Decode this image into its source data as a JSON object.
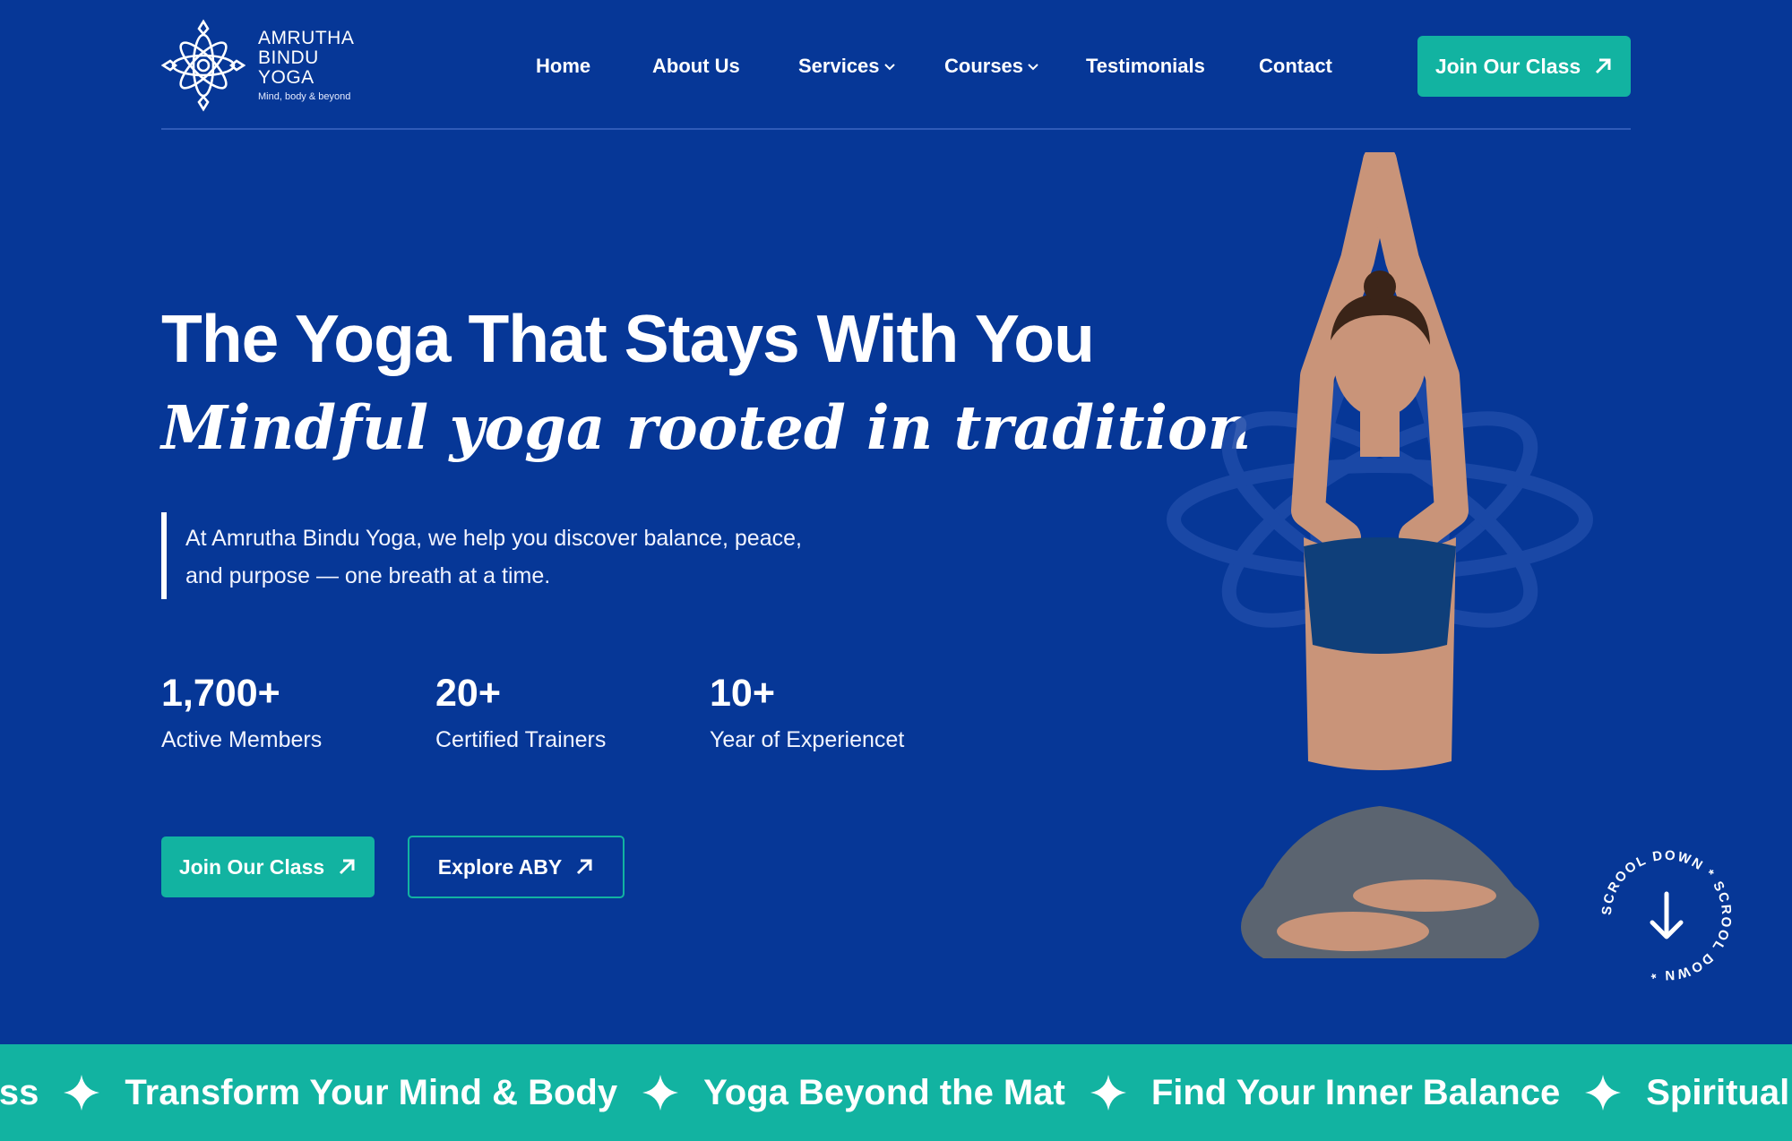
{
  "brand": {
    "line1": "AMRUTHA",
    "line2": "BINDU",
    "line3": "YOGA",
    "tagline": "Mind, body & beyond",
    "logo_icon": "lotus-knot-icon"
  },
  "nav": {
    "items": [
      {
        "label": "Home",
        "has_dropdown": false
      },
      {
        "label": "About Us",
        "has_dropdown": false
      },
      {
        "label": "Services",
        "has_dropdown": true
      },
      {
        "label": "Courses",
        "has_dropdown": true
      },
      {
        "label": "Testimonials",
        "has_dropdown": false
      },
      {
        "label": "Contact",
        "has_dropdown": false
      }
    ],
    "cta_label": "Join Our Class"
  },
  "hero": {
    "headline": "The Yoga That Stays With You",
    "subhead": "Mindful yoga rooted in tradition",
    "intro_line1": "At Amrutha Bindu Yoga, we help you discover balance, peace,",
    "intro_line2": "and purpose — one breath at a time.",
    "stats": [
      {
        "value": "1,700+",
        "label": "Active Members"
      },
      {
        "value": "20+",
        "label": "Certified Trainers"
      },
      {
        "value": "10+",
        "label": "Year of Experiencet"
      }
    ],
    "primary_button": "Join Our Class",
    "secondary_button": "Explore ABY"
  },
  "scroll_badge": {
    "text": "SCROOL DOWN * SCROOL DOWN * ",
    "icon": "arrow-down-icon"
  },
  "marquee": {
    "items": [
      "llness",
      "Transform Your Mind & Body",
      "Yoga Beyond the Mat",
      "Find Your Inner Balance",
      "Spiritual G"
    ]
  },
  "colors": {
    "hero_background": "#063797",
    "accent": "#12b3a1",
    "text": "#ffffff"
  }
}
